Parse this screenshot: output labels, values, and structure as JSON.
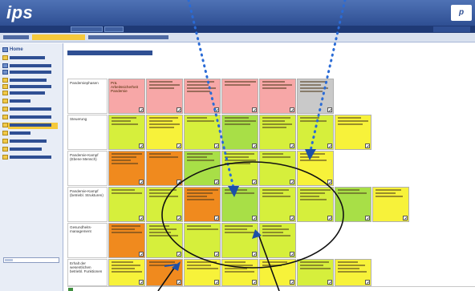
{
  "app": {
    "logo": "ips"
  },
  "sidebar": {
    "home_label": "Home"
  },
  "matrix": {
    "row_labels": [
      "Pandemiephasen",
      "Steuerung",
      "Pandemie-Kampf (Ebene Mensch)",
      "Pandemie-Kampf (betriebl. Strukturen)",
      "Gesundheits-management",
      "Erhalt der wesentlichen betriebl. Funktionen"
    ],
    "first_cell_text": "Prä. Arbeitssicherheit Pandemie"
  },
  "colors": {
    "pink": "#f7a7a7",
    "gray": "#c9c9c9",
    "yellow": "#f7f23a",
    "lime": "#a8df47",
    "orange": "#f08a1e",
    "yellowgreen": "#d6ef3c",
    "annotation_blue": "#2a6bd6",
    "annotation_arrow": "#1d4fa8"
  },
  "icons": [
    "home-icon",
    "folder-icon",
    "edit-icon",
    "logo-icon"
  ]
}
